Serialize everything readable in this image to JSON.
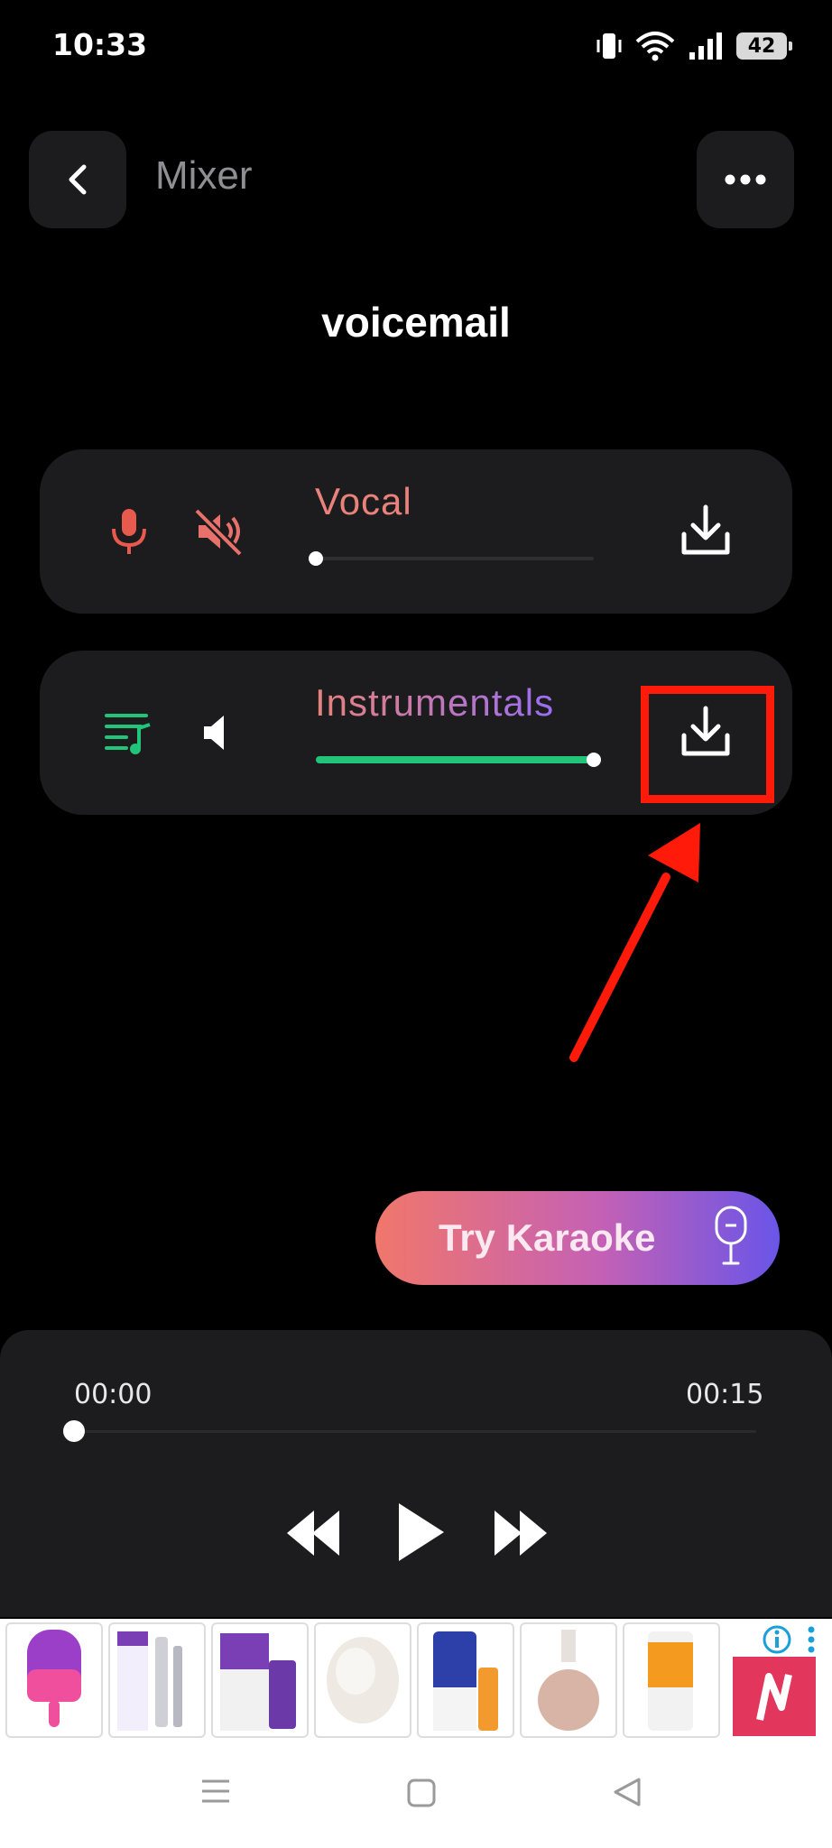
{
  "status_bar": {
    "time": "10:33",
    "battery": "42"
  },
  "header": {
    "title": "Mixer",
    "back_icon": "chevron-left-icon",
    "more_icon": "more-horizontal-icon"
  },
  "song": {
    "title": "voicemail"
  },
  "tracks": [
    {
      "label": "Vocal",
      "level": 0.0,
      "muted": true,
      "colors": {
        "label": "#e8827b",
        "icon": "#e8594e"
      }
    },
    {
      "label": "Instrumentals",
      "level": 1.0,
      "muted": false,
      "colors": {
        "fill": "#22c47a",
        "icon": "#22c47a"
      }
    }
  ],
  "karaoke": {
    "label": "Try Karaoke"
  },
  "player": {
    "current_time": "00:00",
    "total_time": "00:15",
    "progress": 0.0
  },
  "annotation": {
    "color": "#ff1a0a"
  }
}
